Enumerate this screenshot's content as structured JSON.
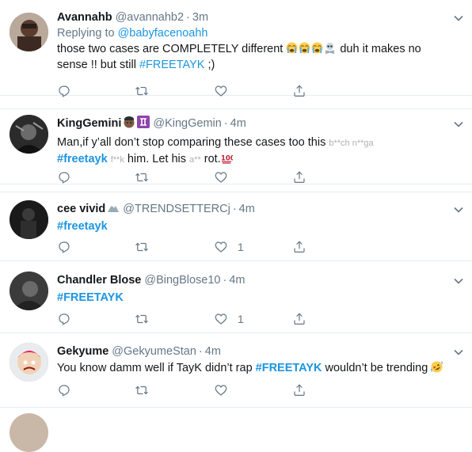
{
  "tweets": [
    {
      "name": "Avannahb",
      "handle": "@avannahb2",
      "sep": "·",
      "time": "3m",
      "reply_prefix": "Replying to ",
      "reply_to": "@babyfacenoahh",
      "text_1": "those two cases are COMPLETELY different ",
      "text_2": " duh it makes no",
      "text_3": "sense !! but still ",
      "hashtag": "#FREETAYK",
      "text_4": " ;)"
    },
    {
      "name": "KingGemini",
      "handle": "@KingGemin",
      "sep": "·",
      "time": "4m",
      "text_1": "Man,if y’all don’t stop comparing these cases too this ",
      "text_censored_1": "b**ch n**ga",
      "hashtag": "#freetayk",
      "text_2": " ",
      "text_censored_2": "f**k",
      "text_3": " him. Let his ",
      "text_censored_3": "a**",
      "text_4": " rot."
    },
    {
      "name": "cee vivid",
      "handle": "@TRENDSETTERCj",
      "sep": "·",
      "time": "4m",
      "hashtag": "#freetayk",
      "like_count": "1"
    },
    {
      "name": "Chandler Blose",
      "handle": "@BingBlose10",
      "sep": "·",
      "time": "4m",
      "hashtag": "#FREETAYK",
      "like_count": "1"
    },
    {
      "name": "Gekyume",
      "handle": "@GekyumeStan",
      "sep": "·",
      "time": "4m",
      "text_1": "You know damm well if TayK didn’t rap ",
      "hashtag": "#FREETAYK",
      "text_2": " wouldn’t be trending "
    }
  ],
  "colors": {
    "link": "#1b95e0",
    "secondary": "#657786",
    "border": "#e6ecf0"
  },
  "icons": [
    "reply-icon",
    "retweet-icon",
    "like-icon",
    "share-icon",
    "chevron-down-icon"
  ]
}
